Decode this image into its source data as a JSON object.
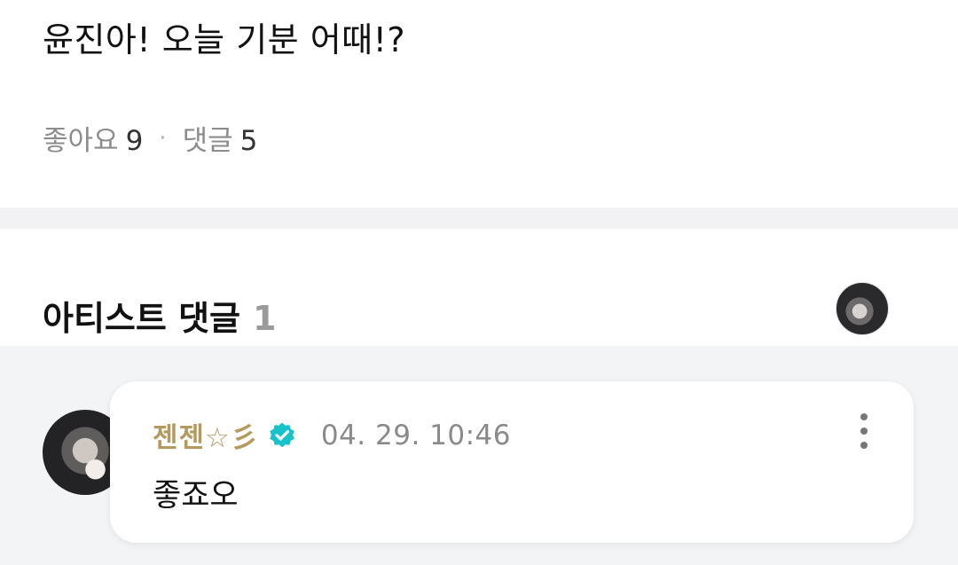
{
  "post": {
    "text": "윤진아! 오늘 기분 어때!?",
    "likes_label": "좋아요",
    "likes_count": "9",
    "separator": "·",
    "comments_label": "댓글",
    "comments_count": "5"
  },
  "artist_comments": {
    "title": "아티스트 댓글",
    "count": "1"
  },
  "comment": {
    "author": "젠젠☆彡",
    "timestamp": "04. 29. 10:46",
    "text": "좋죠오"
  },
  "colors": {
    "author": "#b39a5e",
    "verified_badge": "#18c2c9",
    "background_gray": "#f3f4f6"
  },
  "icons": {
    "verified": "verified-badge-icon",
    "more": "more-vertical-icon"
  }
}
